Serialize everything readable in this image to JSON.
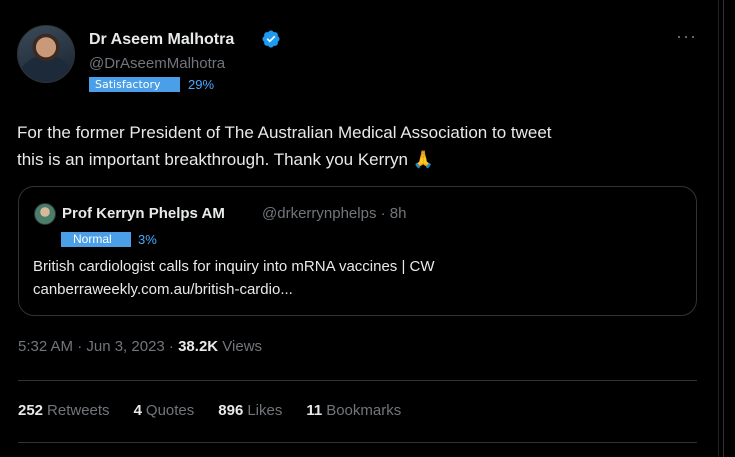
{
  "author": {
    "name": "Dr Aseem Malhotra",
    "handle": "@DrAseemMalhotra",
    "badge_label": "Satisfactory",
    "badge_percent": "29%"
  },
  "more_label": "···",
  "tweet": {
    "line1": "For the former President of The Australian Medical Association to tweet",
    "line2": "this is an important breakthrough. Thank you Kerryn 🙏"
  },
  "quote": {
    "name": "Prof Kerryn Phelps AM",
    "handle_time": "@drkerrynphelps · 8h",
    "badge_label": "Normal",
    "badge_percent": "3%",
    "line1": "British cardiologist calls for inquiry into mRNA vaccines | CW",
    "line2": "canberraweekly.com.au/british-cardio..."
  },
  "meta": {
    "timestamp": "5:32 AM · Jun 3, 2023 · ",
    "views_count": "38.2K",
    "views_label": " Views"
  },
  "stats": [
    {
      "count": "252",
      "label": "Retweets"
    },
    {
      "count": "4",
      "label": "Quotes"
    },
    {
      "count": "896",
      "label": "Likes"
    },
    {
      "count": "11",
      "label": "Bookmarks"
    }
  ],
  "colors": {
    "accent": "#1d9bf0",
    "badge_bg": "#4a9fe8",
    "percent": "#4aa8ff",
    "muted": "#71767b"
  }
}
